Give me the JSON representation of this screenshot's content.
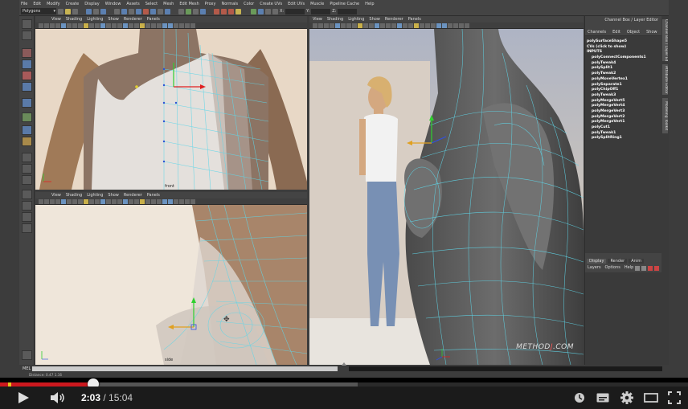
{
  "maya": {
    "menus": [
      "File",
      "Edit",
      "Modify",
      "Create",
      "Display",
      "Window",
      "Assets",
      "Select",
      "Mesh",
      "Edit Mesh",
      "Proxy",
      "Normals",
      "Color",
      "Create UVs",
      "Edit UVs",
      "Muscle",
      "Pipeline Cache",
      "Help"
    ],
    "mode": "Polygons",
    "status_axes": [
      "X:",
      "Y:",
      "Z:"
    ],
    "viewport_menus": [
      "View",
      "Shading",
      "Lighting",
      "Show",
      "Renderer",
      "Panels"
    ],
    "viewport_labels": {
      "top_left": "front",
      "bottom_left": "side"
    },
    "channel_box_title": "Channel Box / Layer Editor",
    "channel_menus": [
      "Channels",
      "Edit",
      "Object",
      "Show"
    ],
    "history": {
      "shape": "polySurfaceShape5",
      "cvs": "CVs (click to show)",
      "inputs_label": "INPUTS",
      "items": [
        "polyConnectComponents1",
        "polyTweak4",
        "polySplit1",
        "polyTweak2",
        "polyMoveVertex1",
        "polySeparate1",
        "polyChipOff1",
        "polyTweak3",
        "polyMergeVert5",
        "polyMergeVert4",
        "polyMergeVert3",
        "polyMergeVert2",
        "polyMergeVert1",
        "polyCut1",
        "polyTweak1",
        "polySplitRing1"
      ]
    },
    "layer_tabs": [
      "Display",
      "Render",
      "Anim"
    ],
    "layer_menus": [
      "Layers",
      "Options",
      "Help"
    ],
    "side_tabs": [
      "Channel Box / Layer Editor",
      "Attribute Editor",
      "Modeling Toolkit"
    ],
    "mel_label": "MEL",
    "help_line": "Distance: 0.47  1.16",
    "watermark": {
      "pre": "METHOD",
      "mid": "J",
      "post": ".COM"
    }
  },
  "player": {
    "current_time": "2:03",
    "separator": " / ",
    "duration": "15:04",
    "progress_played": 0.136,
    "progress_loaded": 0.52,
    "colors": {
      "played": "#cc181e",
      "ad_marker": "#e8c01c",
      "bar_bg": "#1b1b1b"
    }
  }
}
